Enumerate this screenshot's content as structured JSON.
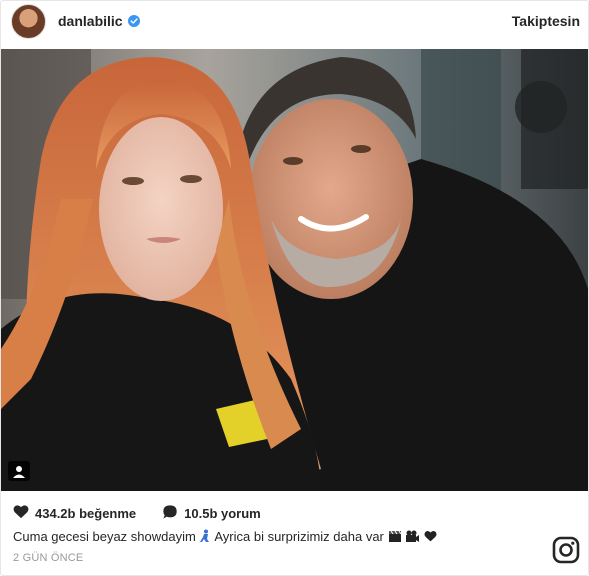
{
  "post": {
    "username": "danlabilic",
    "follow_label": "Takiptesin",
    "likes_label": "434.2b beğenme",
    "comments_label": "10.5b yorum",
    "caption_text": "Cuma gecesi beyaz showdayim",
    "caption_text_2": "Ayrica bi surprizimiz daha var",
    "timestamp": "2 GÜN ÖNCE"
  },
  "icons": {
    "verified": "verified-badge-icon",
    "heart": "heart-icon",
    "comment": "comment-bubble-icon",
    "user_tag": "user-tag-icon",
    "instagram": "instagram-logo-icon",
    "caption_emoji_1": "dancer-emoji-icon",
    "caption_emoji_2": "clapperboard-emoji-icon",
    "caption_emoji_3": "film-camera-emoji-icon",
    "caption_emoji_4": "black-heart-emoji-icon"
  },
  "colors": {
    "verified_blue": "#3897f0",
    "text_primary": "#262626",
    "text_secondary": "#999999",
    "border": "#e6e6e6"
  }
}
